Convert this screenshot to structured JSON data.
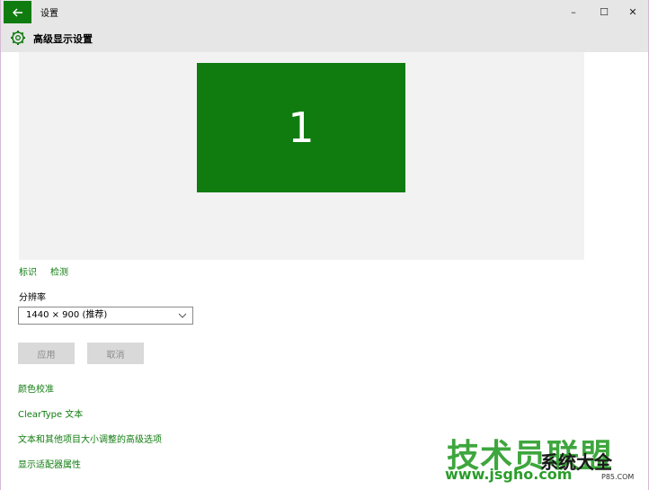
{
  "window": {
    "title": "设置",
    "minimize_glyph": "–",
    "maximize_glyph": "☐",
    "close_glyph": "✕"
  },
  "header": {
    "title": "高级显示设置"
  },
  "preview": {
    "monitor_label": "1"
  },
  "links": {
    "identify": "标识",
    "detect": "检测",
    "color_calibration": "颜色校准",
    "cleartype": "ClearType 文本",
    "advanced_sizing": "文本和其他项目大小调整的高级选项",
    "adapter_properties": "显示适配器属性"
  },
  "resolution": {
    "label": "分辨率",
    "selected": "1440 × 900 (推荐)"
  },
  "buttons": {
    "apply": "应用",
    "cancel": "取消"
  },
  "watermark": {
    "main": "技术员联盟",
    "side": "系统大全",
    "url": "www.jsgho.com",
    "sub": "P85.COM"
  },
  "colors": {
    "accent": "#107c10",
    "chrome": "#e6e6e6",
    "preview_bg": "#f2f2f2"
  }
}
